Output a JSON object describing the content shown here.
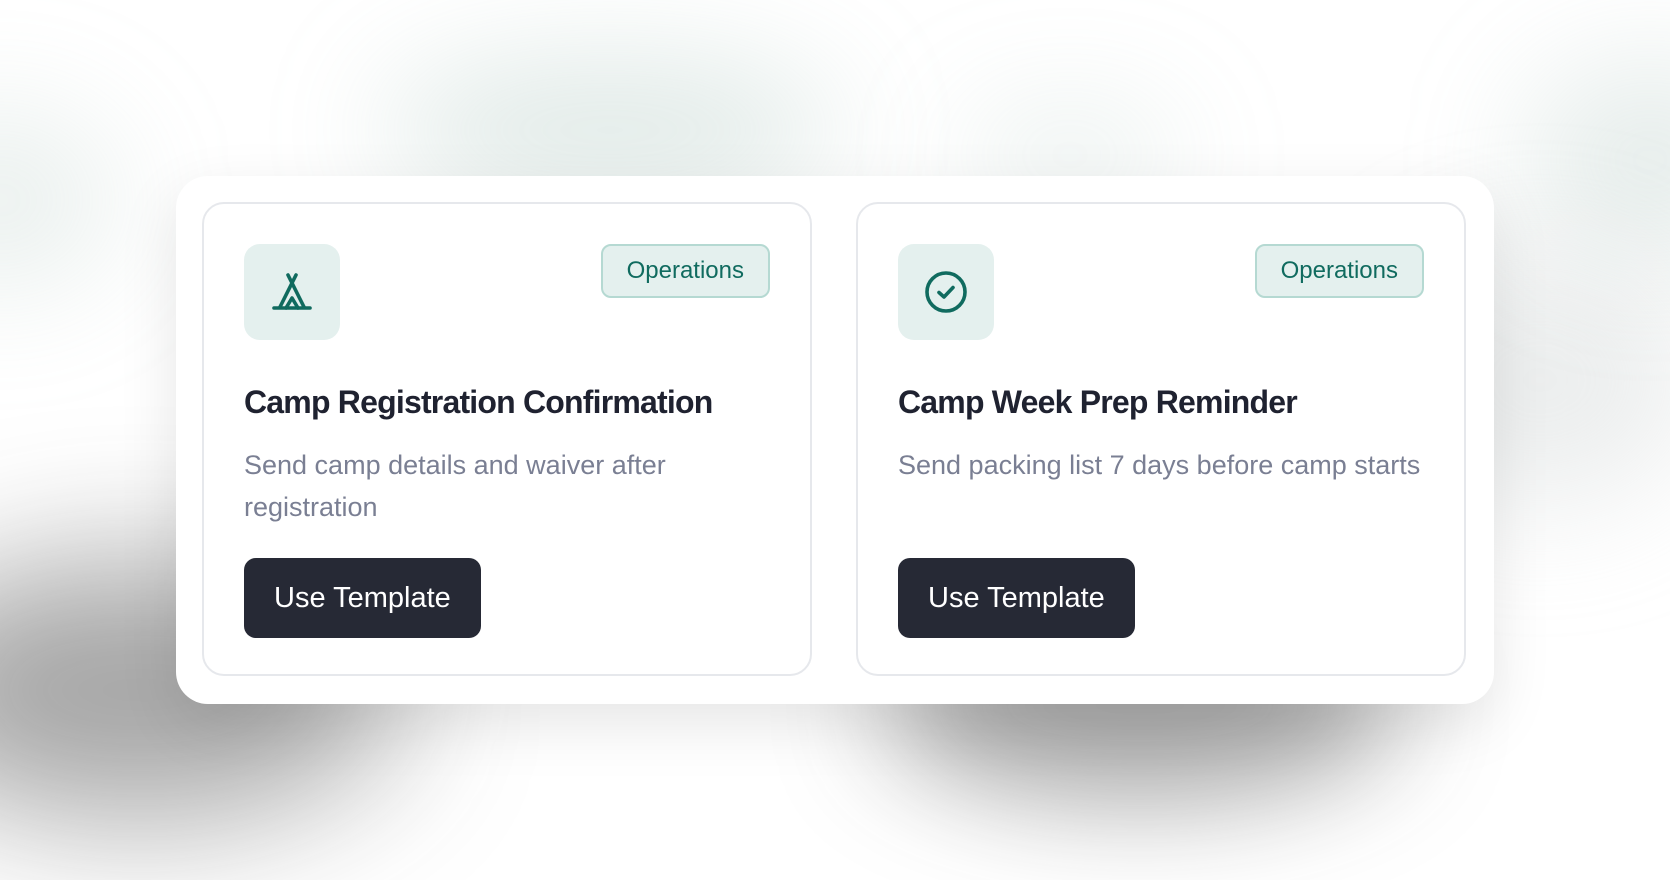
{
  "templates": [
    {
      "icon": "tent-icon",
      "category": "Operations",
      "title": "Camp Registration Confirmation",
      "description": "Send camp details and waiver after registration",
      "button_label": "Use Template"
    },
    {
      "icon": "check-circle-icon",
      "category": "Operations",
      "title": "Camp Week Prep Reminder",
      "description": "Send packing list 7 days before camp starts",
      "button_label": "Use Template"
    }
  ],
  "colors": {
    "accent": "#106b5f",
    "icon_bg": "#e4f0ee",
    "badge_border": "#b5d9d2",
    "button_bg": "#262935",
    "title": "#1f2230",
    "description": "#7a7f93"
  }
}
